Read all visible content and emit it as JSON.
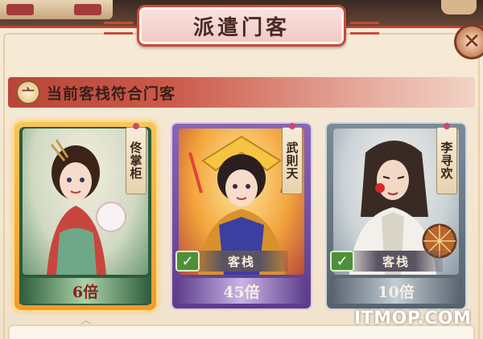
{
  "dialog": {
    "title": "派遣门客",
    "close_icon": "close-icon"
  },
  "section": {
    "icon_glyph": "亠",
    "title": "当前客栈符合门客"
  },
  "cards": [
    {
      "name": "佟掌柜",
      "multiplier": "6倍",
      "status": "",
      "selected": true,
      "frame_color": "#f2a33a",
      "theme_color": "#2e5b3a"
    },
    {
      "name": "武則天",
      "multiplier": "45倍",
      "status": "客栈",
      "check_icon": "check-icon",
      "selected": false,
      "frame_color": "#6e4aa0",
      "theme_color": "#5c3c8a"
    },
    {
      "name": "李寻欢",
      "multiplier": "10倍",
      "status": "客栈",
      "check_icon": "check-icon",
      "selected": false,
      "frame_color": "#6e7a86",
      "theme_color": "#56626e"
    }
  ],
  "watermark": "ITMOP.COM"
}
